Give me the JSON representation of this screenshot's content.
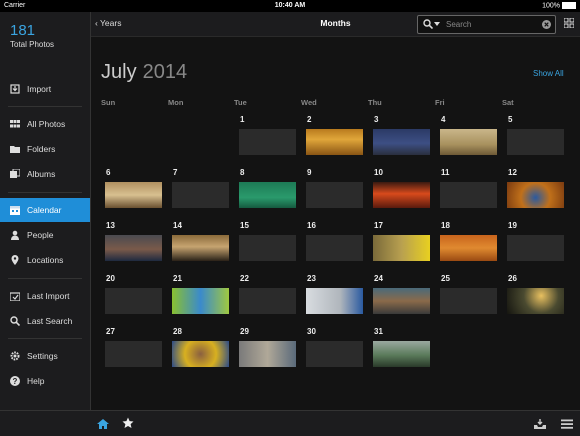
{
  "status": {
    "carrier": "Carrier",
    "time": "10:40 AM",
    "battery": "100%"
  },
  "sidebar": {
    "count": "181",
    "total_label": "Total Photos",
    "items": [
      {
        "label": "Import"
      },
      {
        "label": "All Photos"
      },
      {
        "label": "Folders"
      },
      {
        "label": "Albums"
      },
      {
        "label": "Calendar"
      },
      {
        "label": "People"
      },
      {
        "label": "Locations"
      },
      {
        "label": "Last Import"
      },
      {
        "label": "Last Search"
      },
      {
        "label": "Settings"
      },
      {
        "label": "Help"
      }
    ]
  },
  "topbar": {
    "back_label": "Years",
    "title": "Months",
    "search_placeholder": "Search"
  },
  "calendar": {
    "month": "July",
    "year": "2014",
    "show_all": "Show All",
    "weekdays": [
      "Sun",
      "Mon",
      "Tue",
      "Wed",
      "Thu",
      "Fri",
      "Sat"
    ],
    "days": [
      "1",
      "2",
      "3",
      "4",
      "5",
      "6",
      "7",
      "8",
      "9",
      "10",
      "11",
      "12",
      "13",
      "14",
      "15",
      "16",
      "17",
      "18",
      "19",
      "20",
      "21",
      "22",
      "23",
      "24",
      "25",
      "26",
      "27",
      "28",
      "29",
      "30",
      "31"
    ]
  },
  "colors": {
    "accent": "#1f8ed8",
    "link": "#3aa4e0"
  }
}
